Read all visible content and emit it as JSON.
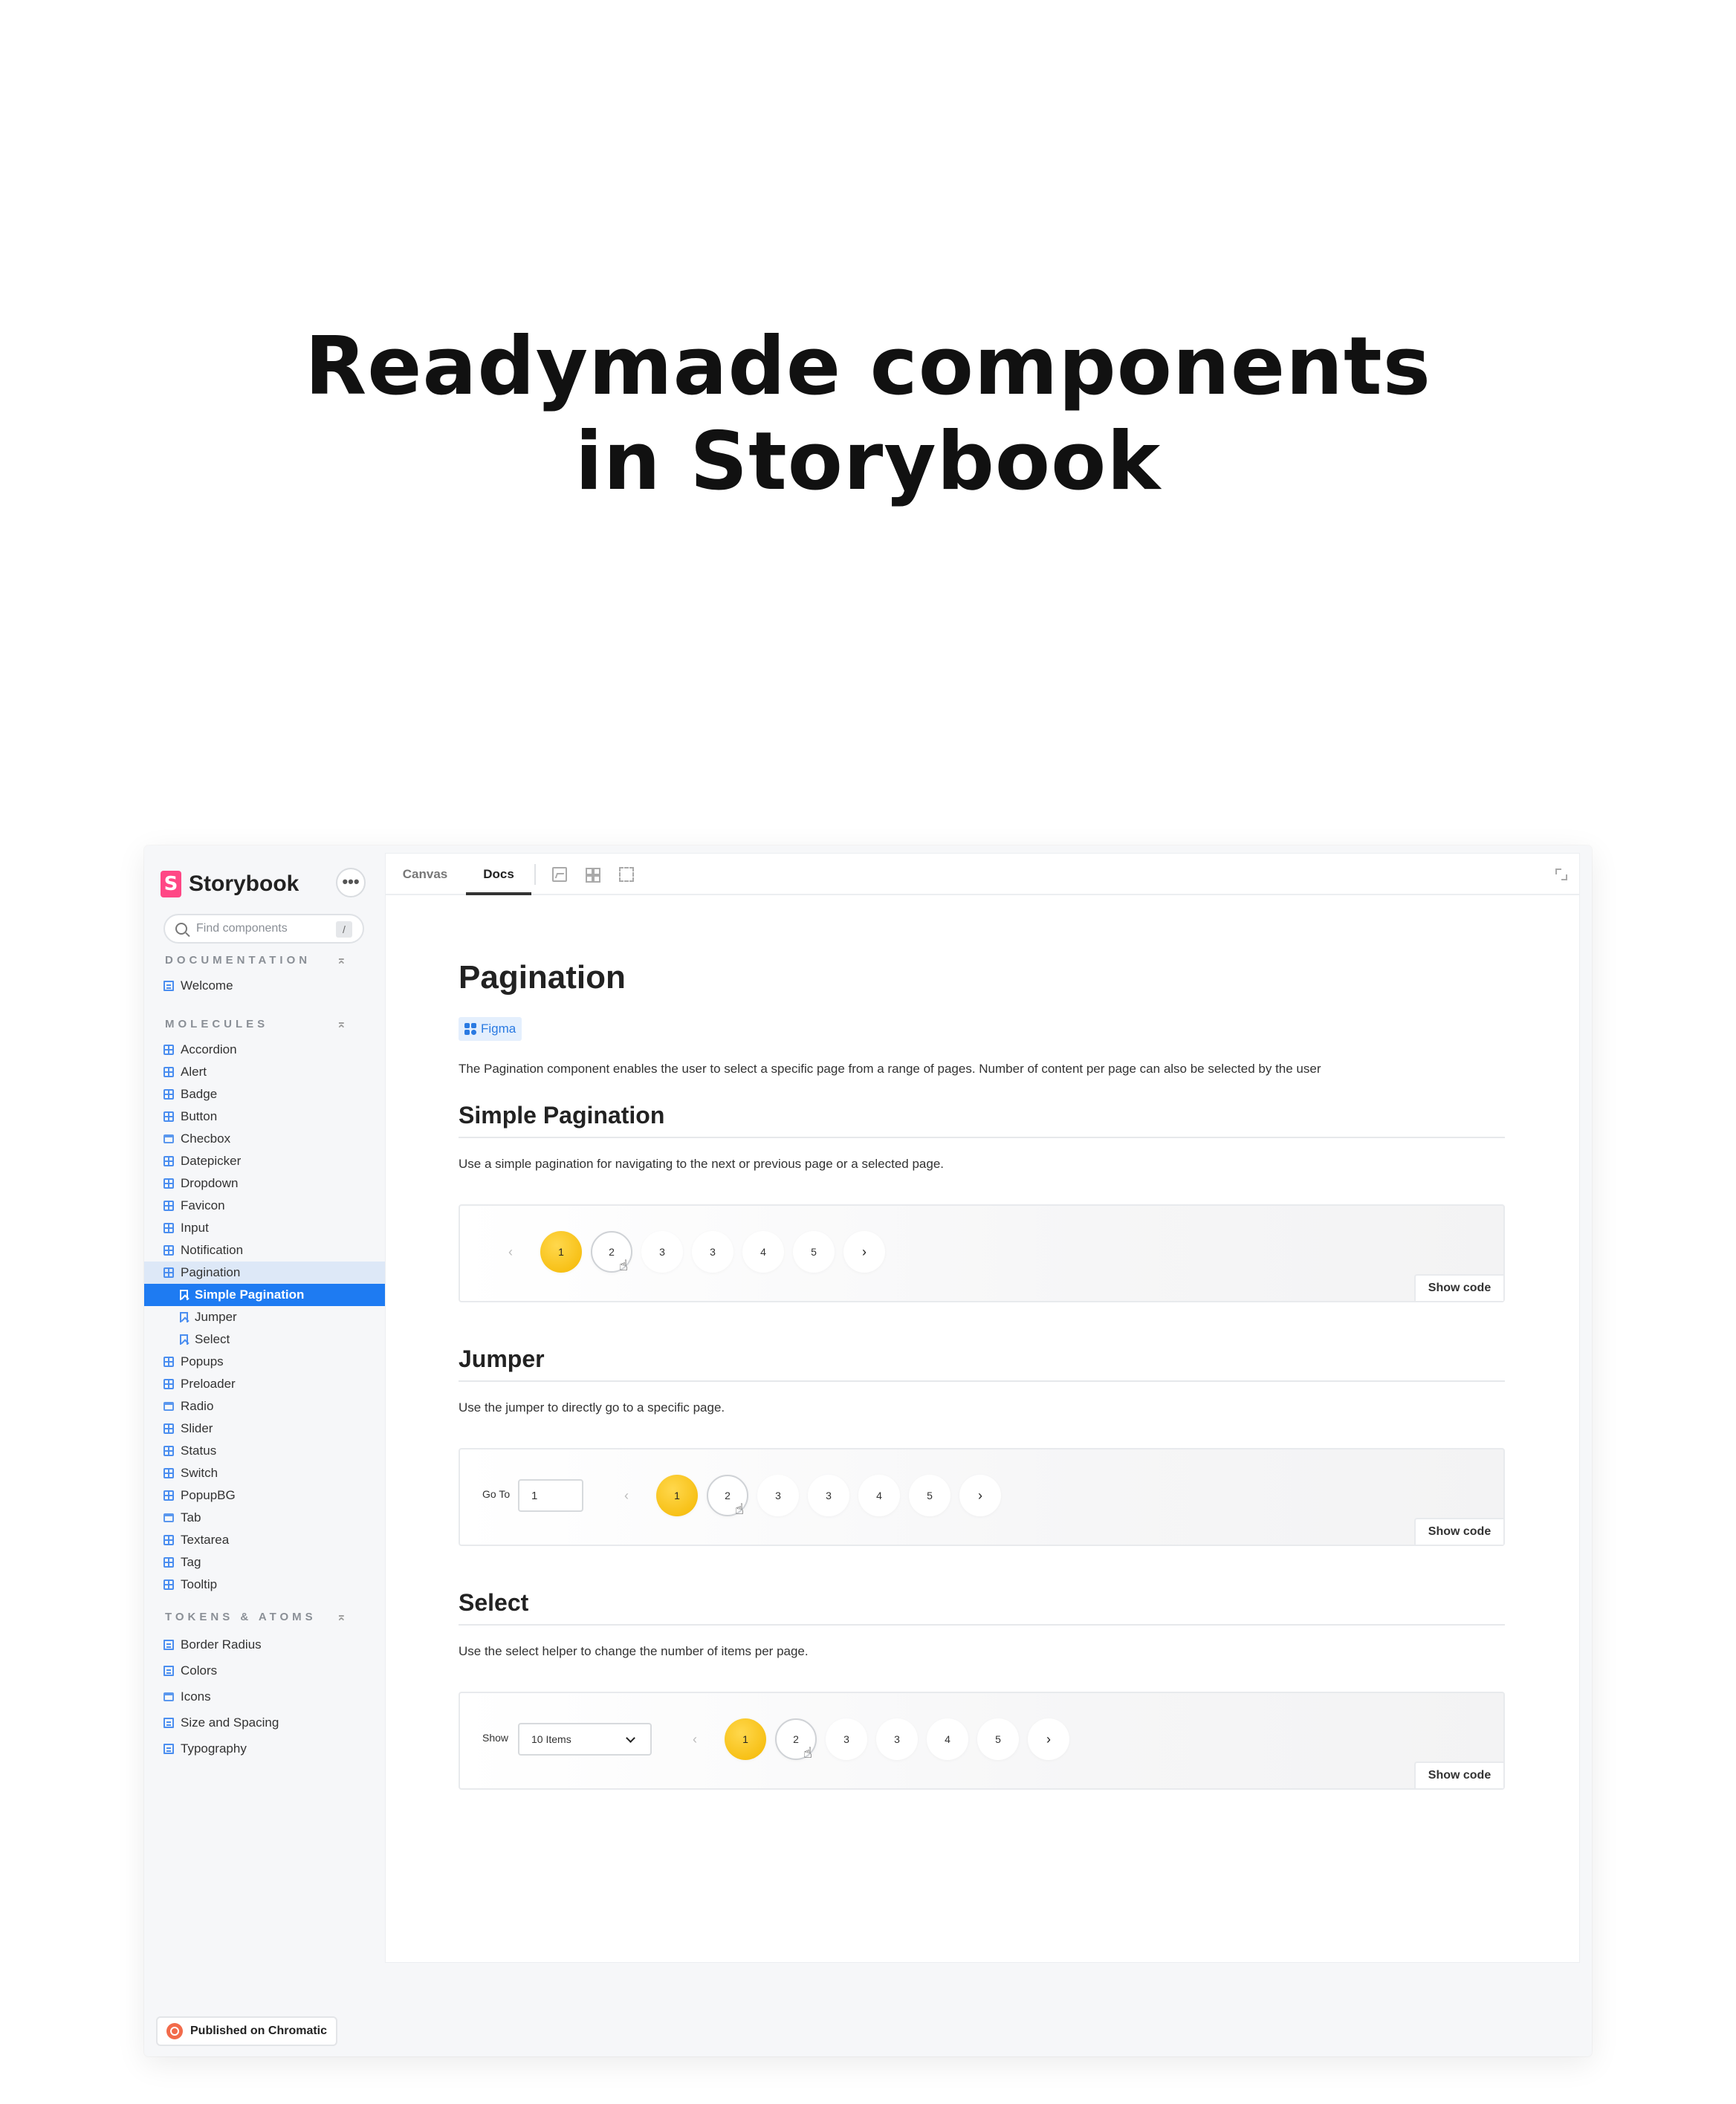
{
  "hero": {
    "line1": "Readymade components",
    "line2": "in Storybook"
  },
  "sidebar": {
    "brand": "Storybook",
    "brand_mark": "S",
    "menu_label": "•••",
    "search": {
      "placeholder": "Find components",
      "shortcut": "/"
    },
    "sections": [
      {
        "title": "DOCUMENTATION",
        "items": [
          {
            "label": "Welcome",
            "icon": "doc-icon"
          }
        ]
      },
      {
        "title": "MOLECULES",
        "items": [
          {
            "label": "Accordion",
            "icon": "component-icon"
          },
          {
            "label": "Alert",
            "icon": "component-icon"
          },
          {
            "label": "Badge",
            "icon": "component-icon"
          },
          {
            "label": "Button",
            "icon": "component-icon"
          },
          {
            "label": "Checbox",
            "icon": "folder-icon"
          },
          {
            "label": "Datepicker",
            "icon": "component-icon"
          },
          {
            "label": "Dropdown",
            "icon": "component-icon"
          },
          {
            "label": "Favicon",
            "icon": "component-icon"
          },
          {
            "label": "Input",
            "icon": "component-icon"
          },
          {
            "label": "Notification",
            "icon": "component-icon"
          },
          {
            "label": "Pagination",
            "icon": "component-icon"
          },
          {
            "label": "Simple Pagination",
            "icon": "story-icon"
          },
          {
            "label": "Jumper",
            "icon": "story-icon"
          },
          {
            "label": "Select",
            "icon": "story-icon"
          },
          {
            "label": "Popups",
            "icon": "component-icon"
          },
          {
            "label": "Preloader",
            "icon": "component-icon"
          },
          {
            "label": "Radio",
            "icon": "folder-icon"
          },
          {
            "label": "Slider",
            "icon": "component-icon"
          },
          {
            "label": "Status",
            "icon": "component-icon"
          },
          {
            "label": "Switch",
            "icon": "component-icon"
          },
          {
            "label": "PopupBG",
            "icon": "component-icon"
          },
          {
            "label": "Tab",
            "icon": "folder-icon"
          },
          {
            "label": "Textarea",
            "icon": "component-icon"
          },
          {
            "label": "Tag",
            "icon": "component-icon"
          },
          {
            "label": "Tooltip",
            "icon": "component-icon"
          }
        ]
      },
      {
        "title": "TOKENS & ATOMS",
        "items": [
          {
            "label": "Border Radius",
            "icon": "doc-icon"
          },
          {
            "label": "Colors",
            "icon": "doc-icon"
          },
          {
            "label": "Icons",
            "icon": "folder-icon"
          },
          {
            "label": "Size and Spacing",
            "icon": "doc-icon"
          },
          {
            "label": "Typography",
            "icon": "doc-icon"
          }
        ]
      }
    ],
    "selected_item": "Simple Pagination",
    "footer": "Published on Chromatic"
  },
  "toolbar": {
    "tabs": [
      "Canvas",
      "Docs"
    ],
    "active_tab": "Docs"
  },
  "docs": {
    "title": "Pagination",
    "figma_tag": "Figma",
    "intro": "The Pagination component enables the user to select a specific page from a range of pages. Number of content per page can also be selected by the user",
    "show_code": "Show code",
    "stories": [
      {
        "heading": "Simple Pagination",
        "description": "Use a simple pagination for navigating to the next or previous page or a selected page.",
        "pages": [
          "1",
          "2",
          "3",
          "3",
          "4",
          "5"
        ],
        "current_page": "1"
      },
      {
        "heading": "Jumper",
        "description": "Use the jumper to directly go to a specific page.",
        "goto_label": "Go To",
        "goto_value": "1",
        "pages": [
          "1",
          "2",
          "3",
          "3",
          "4",
          "5"
        ],
        "current_page": "1"
      },
      {
        "heading": "Select",
        "description": "Use the select helper to change the number of items per page.",
        "show_label": "Show",
        "select_value": "10 Items",
        "pages": [
          "1",
          "2",
          "3",
          "3",
          "4",
          "5"
        ],
        "current_page": "1"
      }
    ],
    "prev_glyph": "‹",
    "next_glyph": "›"
  },
  "colors": {
    "brand": "#ff4785",
    "active_nav": "#1e7bf2",
    "active_page": "#f4b700",
    "figma_tag_bg": "#e4effd"
  }
}
